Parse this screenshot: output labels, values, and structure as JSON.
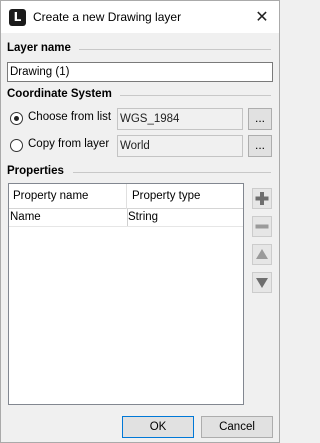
{
  "window": {
    "title": "Create a new Drawing layer",
    "app_icon_letter": "L",
    "close_glyph": "✕"
  },
  "layer_name": {
    "section_title": "Layer name",
    "value": "Drawing (1)"
  },
  "coordinate_system": {
    "section_title": "Coordinate System",
    "choose_from_list": {
      "label": "Choose from list",
      "value": "WGS_1984",
      "selected": true,
      "browse_label": "..."
    },
    "copy_from_layer": {
      "label": "Copy from layer",
      "value": "World",
      "selected": false,
      "browse_label": "..."
    }
  },
  "properties": {
    "section_title": "Properties",
    "columns": [
      "Property name",
      "Property type"
    ],
    "rows": [
      {
        "name": "Name",
        "type": "String"
      }
    ],
    "side_buttons": [
      {
        "icon": "add-icon",
        "color": "#6e6e6e"
      },
      {
        "icon": "remove-icon",
        "color": "#9a9a9a"
      },
      {
        "icon": "move-up-icon",
        "color": "#9a9a9a"
      },
      {
        "icon": "move-down-icon",
        "color": "#6e6e6e"
      }
    ]
  },
  "footer": {
    "ok_label": "OK",
    "cancel_label": "Cancel"
  }
}
